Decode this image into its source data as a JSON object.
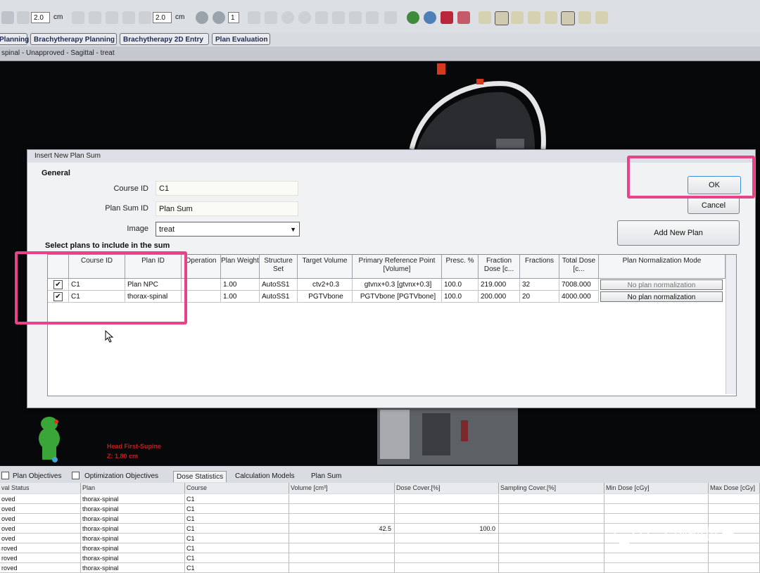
{
  "toolbar": {
    "zoom1": "2.0",
    "unit1": "cm",
    "zoom2": "2.0",
    "unit2": "cm",
    "counter": "1"
  },
  "workspace_tabs": [
    "Planning",
    "Brachytherapy Planning",
    "Brachytherapy 2D Entry",
    "Plan Evaluation"
  ],
  "status_line": "spinal - Unapproved - Sagittal - treat",
  "viewport": {
    "orientation_label": "Head First-Supine",
    "z_label": "Z: 1.80 cm"
  },
  "dialog": {
    "title": "Insert New Plan Sum",
    "section_general": "General",
    "course_id_label": "Course ID",
    "course_id_value": "C1",
    "plan_sum_id_label": "Plan Sum ID",
    "plan_sum_id_value": "Plan Sum",
    "image_label": "Image",
    "image_value": "treat",
    "ok_label": "OK",
    "cancel_label": "Cancel",
    "add_plan_label": "Add New Plan",
    "section_select": "Select plans to include in the sum",
    "columns": [
      "Course ID",
      "Plan ID",
      "Operation",
      "Plan Weight",
      "Structure Set",
      "Target Volume",
      "Primary Reference Point [Volume]",
      "Presc. %",
      "Fraction Dose [c...",
      "Fractions",
      "Total Dose [c...",
      "Plan Normalization Mode"
    ],
    "rows": [
      {
        "checked": "✔",
        "course": "C1",
        "plan": "Plan NPC",
        "op": "",
        "weight": "1.00",
        "ss": "AutoSS1",
        "target": "ctv2+0.3",
        "ref": "gtvnx+0.3 [gtvnx+0.3]",
        "presc": "100.0",
        "fxdose": "219.000",
        "fx": "32",
        "total": "7008.000",
        "norm": "No plan normalization"
      },
      {
        "checked": "✔",
        "course": "C1",
        "plan": "thorax-spinal",
        "op": "",
        "weight": "1.00",
        "ss": "AutoSS1",
        "target": "PGTVbone",
        "ref": "PGTVbone [PGTVbone]",
        "presc": "100.0",
        "fxdose": "200.000",
        "fx": "20",
        "total": "4000.000",
        "norm": "No plan normalization"
      }
    ]
  },
  "bottom": {
    "tabs": [
      "Plan Objectives",
      "Optimization Objectives",
      "Dose Statistics",
      "Calculation Models",
      "Plan Sum"
    ],
    "headers": [
      "val Status",
      "Plan",
      "Course",
      "Volume [cm³]",
      "Dose Cover.[%]",
      "Sampling Cover.[%]",
      "Min Dose [cGy]",
      "Max Dose [cGy]"
    ],
    "rows": [
      {
        "status": "oved",
        "plan": "thorax-spinal",
        "course": "C1",
        "volume": "",
        "cover": ""
      },
      {
        "status": "oved",
        "plan": "thorax-spinal",
        "course": "C1",
        "volume": "",
        "cover": ""
      },
      {
        "status": "oved",
        "plan": "thorax-spinal",
        "course": "C1",
        "volume": "",
        "cover": ""
      },
      {
        "status": "oved",
        "plan": "thorax-spinal",
        "course": "C1",
        "volume": "42.5",
        "cover": "100.0"
      },
      {
        "status": "oved",
        "plan": "thorax-spinal",
        "course": "C1",
        "volume": "",
        "cover": ""
      },
      {
        "status": "roved",
        "plan": "thorax-spinal",
        "course": "C1",
        "volume": "",
        "cover": ""
      },
      {
        "status": "roved",
        "plan": "thorax-spinal",
        "course": "C1",
        "volume": "",
        "cover": ""
      },
      {
        "status": "roved",
        "plan": "thorax-spinal",
        "course": "C1",
        "volume": "",
        "cover": ""
      }
    ]
  },
  "watermark": "医学物理世界",
  "colors": {
    "highlight": "#e8438a",
    "accent": "#1d2a55",
    "bone": "#e6e6e6"
  }
}
